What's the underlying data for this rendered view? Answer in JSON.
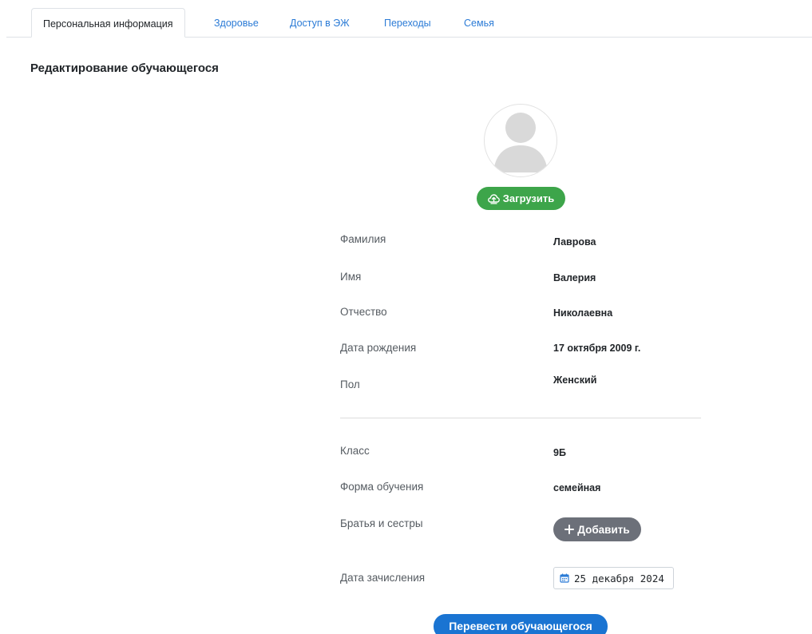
{
  "tabs": [
    {
      "label": "Персональная информация",
      "active": true
    },
    {
      "label": "Здоровье",
      "active": false
    },
    {
      "label": "Доступ в ЭЖ",
      "active": false
    },
    {
      "label": "Переходы",
      "active": false
    },
    {
      "label": "Семья",
      "active": false
    }
  ],
  "page_title": "Редактирование обучающегося",
  "avatar": {
    "icon": "user-silhouette-icon"
  },
  "upload_button": {
    "label": "Загрузить",
    "icon": "cloud-upload-icon",
    "color": "#3da54a"
  },
  "personal": {
    "surname": {
      "label": "Фамилия",
      "value": "Лаврова"
    },
    "name": {
      "label": "Имя",
      "value": "Валерия"
    },
    "patronymic": {
      "label": "Отчество",
      "value": "Николаевна"
    },
    "birthdate": {
      "label": "Дата рождения",
      "value": "17 октября 2009 г."
    },
    "gender": {
      "label": "Пол",
      "value": "Женский"
    }
  },
  "education": {
    "class": {
      "label": "Класс",
      "value": "9Б"
    },
    "form": {
      "label": "Форма обучения",
      "value": "семейная"
    },
    "siblings": {
      "label": "Братья и сестры",
      "button_label": "Добавить"
    },
    "enrollment": {
      "label": "Дата зачисления",
      "value": "25 декабря 2024",
      "icon": "calendar-icon"
    }
  },
  "transfer_button": {
    "label": "Перевести обучающегося",
    "color": "#1a74d2"
  }
}
